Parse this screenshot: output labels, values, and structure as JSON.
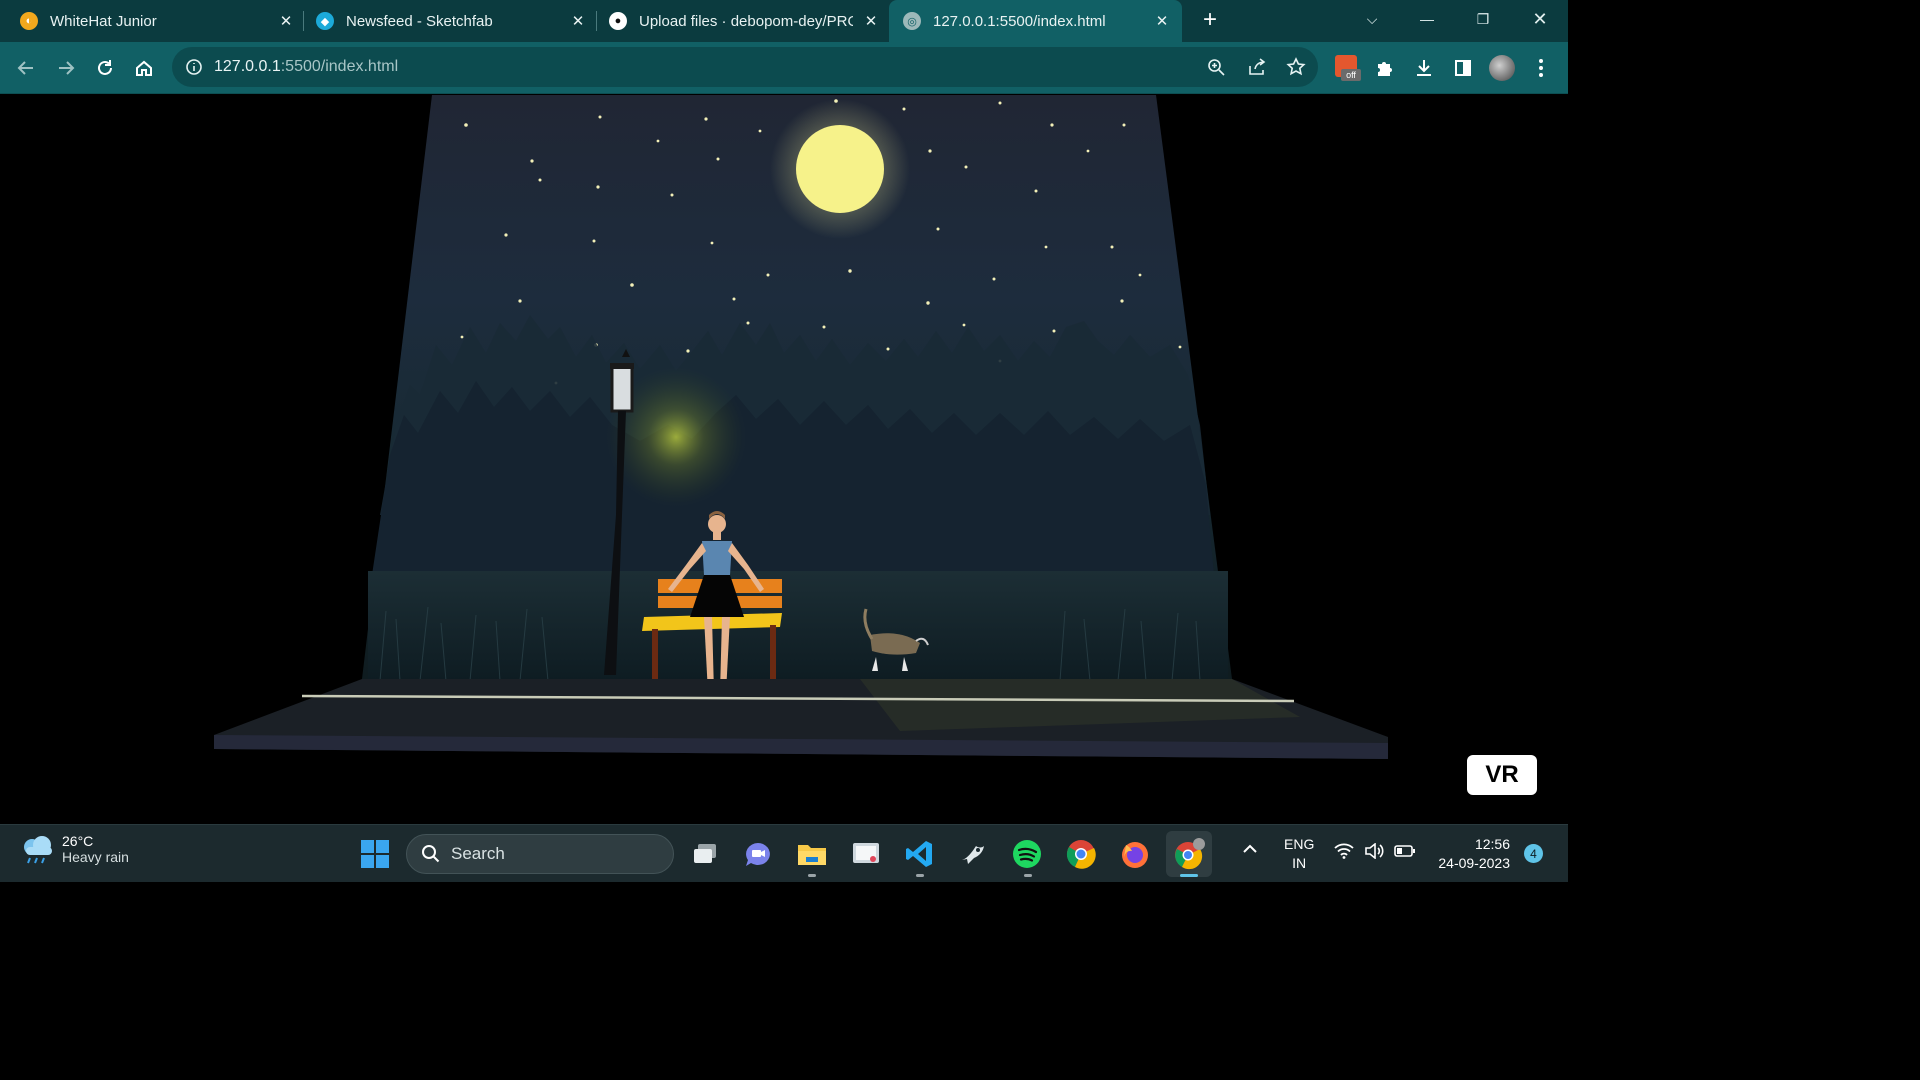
{
  "browser": {
    "tabs": [
      {
        "title": "WhiteHat Junior",
        "icon": "whitehat-icon",
        "color": "#f2a81d"
      },
      {
        "title": "Newsfeed - Sketchfab",
        "icon": "sketchfab-icon",
        "color": "#1caad9"
      },
      {
        "title": "Upload files · debopom-dey/PRO",
        "icon": "github-icon",
        "color": "#ffffff"
      },
      {
        "title": "127.0.0.1:5500/index.html",
        "icon": "globe-icon",
        "color": "#cfe3e3",
        "active": true
      }
    ],
    "address": {
      "host": "127.0.0.1",
      "path": ":5500/index.html"
    }
  },
  "scene": {
    "vr_button": "VR"
  },
  "taskbar": {
    "weather": {
      "temp": "26°C",
      "condition": "Heavy rain"
    },
    "search_label": "Search",
    "lang_top": "ENG",
    "lang_bottom": "IN",
    "time": "12:56",
    "date": "24-09-2023",
    "notifications": "4"
  },
  "colors": {
    "tabstrip": "#0b3b3f",
    "toolbar": "#116065",
    "taskbar": "#1c2a2e",
    "moon": "#f6f28a"
  }
}
